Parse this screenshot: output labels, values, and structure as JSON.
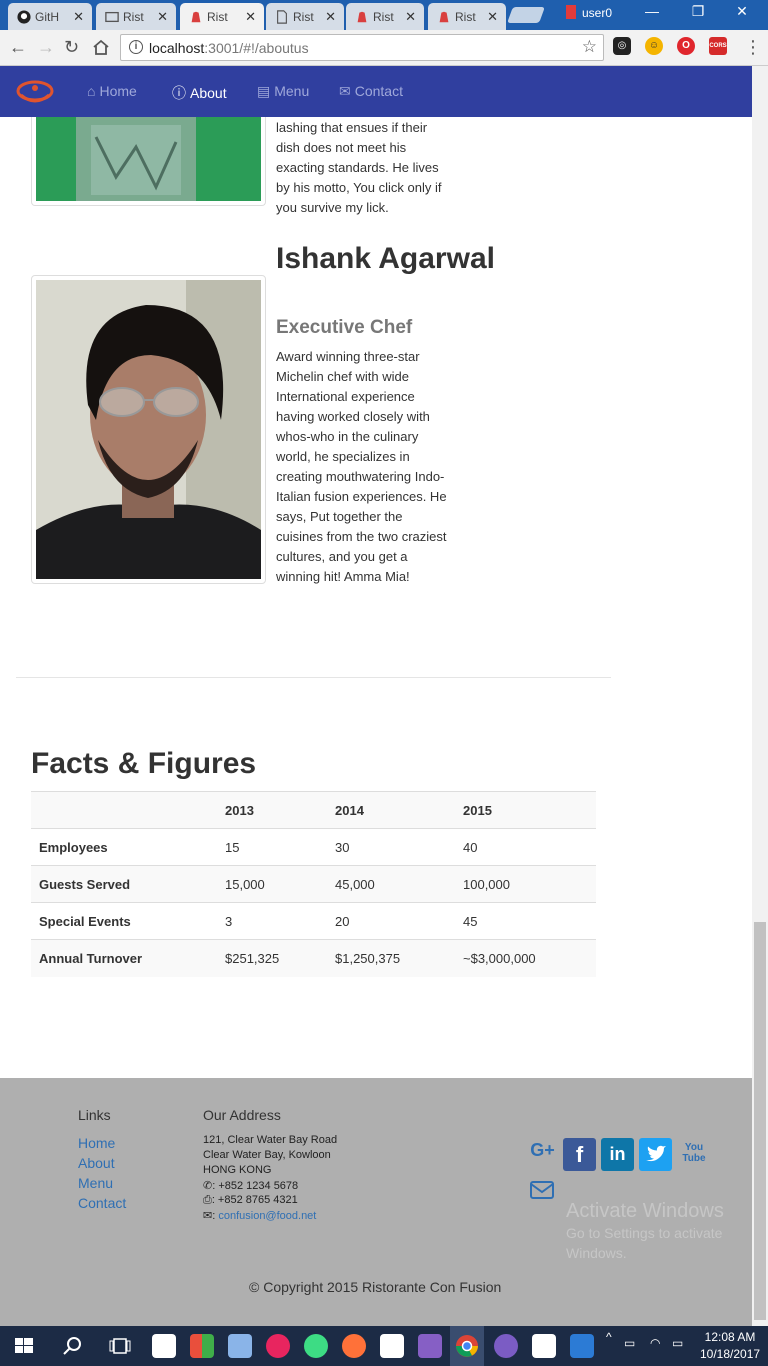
{
  "browser": {
    "tabs": [
      {
        "label": "GitH",
        "icon": "github-icon"
      },
      {
        "label": "Rist",
        "icon": "page-icon"
      },
      {
        "label": "Rist",
        "icon": "ristorante-icon",
        "active": true
      },
      {
        "label": "Rist",
        "icon": "document-icon"
      },
      {
        "label": "Rist",
        "icon": "ristorante-icon"
      },
      {
        "label": "Rist",
        "icon": "ristorante-icon"
      }
    ],
    "user": "user0",
    "url_host": "localhost",
    "url_path": ":3001/#!/aboutus"
  },
  "navbar": {
    "items": [
      {
        "label": "Home",
        "icon": "home-icon"
      },
      {
        "label": "About",
        "icon": "info-icon",
        "active": true
      },
      {
        "label": "Menu",
        "icon": "list-icon"
      },
      {
        "label": "Contact",
        "icon": "envelope-icon"
      }
    ]
  },
  "leaders": {
    "previous_bio_tail": "lashing that ensues if their dish does not meet his exacting standards. He lives by his motto, You click only if you survive my lick.",
    "chef": {
      "name": "Ishank Agarwal",
      "role": "Executive Chef",
      "bio": "Award winning three-star Michelin chef with wide International experience having worked closely with whos-who in the culinary world, he specializes in creating mouthwatering Indo-Italian fusion experiences. He says, Put together the cuisines from the two craziest cultures, and you get a winning hit! Amma Mia!"
    }
  },
  "facts": {
    "title": "Facts & Figures",
    "columns": [
      "",
      "2013",
      "2014",
      "2015"
    ],
    "rows": [
      [
        "Employees",
        "15",
        "30",
        "40"
      ],
      [
        "Guests Served",
        "15,000",
        "45,000",
        "100,000"
      ],
      [
        "Special Events",
        "3",
        "20",
        "45"
      ],
      [
        "Annual Turnover",
        "$251,325",
        "$1,250,375",
        "~$3,000,000"
      ]
    ]
  },
  "footer": {
    "links_heading": "Links",
    "links": [
      "Home",
      "About",
      "Menu",
      "Contact"
    ],
    "address_heading": "Our Address",
    "address_lines": [
      "121, Clear Water Bay Road",
      "Clear Water Bay, Kowloon",
      "HONG KONG"
    ],
    "phone": ": +852 1234 5678",
    "fax": ": +852 8765 4321",
    "email": "confusion@food.net",
    "social": [
      {
        "icon": "google-plus-icon",
        "text": "G+"
      },
      {
        "icon": "facebook-icon",
        "text": "f"
      },
      {
        "icon": "linkedin-icon",
        "text": "in"
      },
      {
        "icon": "twitter-icon",
        "text": ""
      },
      {
        "icon": "youtube-icon",
        "text": "You Tube"
      },
      {
        "icon": "mail-icon",
        "text": ""
      }
    ],
    "copyright": "© Copyright 2015 Ristorante Con Fusion",
    "activate_title": "Activate Windows",
    "activate_sub": "Go to Settings to activate Windows."
  },
  "taskbar": {
    "time": "12:08 AM",
    "date": "10/18/2017"
  },
  "colors": {
    "navbar": "#303f9f",
    "tabstrip": "#1f5fae",
    "footer": "#afafaf",
    "link": "#2f6fb3"
  }
}
